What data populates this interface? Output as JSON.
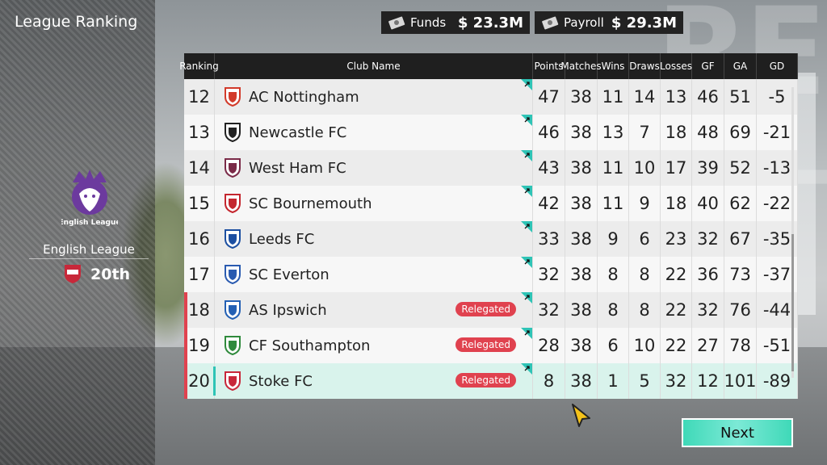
{
  "page": {
    "title": "League Ranking"
  },
  "funds": {
    "label": "Funds",
    "value": "$ 23.3M"
  },
  "payroll": {
    "label": "Payroll",
    "value": "$ 29.3M"
  },
  "league": {
    "logo_text": "English League",
    "name": "English League",
    "rank": "20th"
  },
  "table": {
    "headers": [
      "Ranking",
      "Club Name",
      "Points",
      "Matches",
      "Wins",
      "Draws",
      "Losses",
      "GF",
      "GA",
      "GD"
    ],
    "rows": [
      {
        "rank": "12",
        "club": "AC Nottingham",
        "points": "47",
        "matches": "38",
        "wins": "11",
        "draws": "14",
        "losses": "13",
        "gf": "46",
        "ga": "51",
        "gd": "-5",
        "status": "",
        "crest_color": "#d23a2a"
      },
      {
        "rank": "13",
        "club": "Newcastle FC",
        "points": "46",
        "matches": "38",
        "wins": "13",
        "draws": "7",
        "losses": "18",
        "gf": "48",
        "ga": "69",
        "gd": "-21",
        "status": "",
        "crest_color": "#222222"
      },
      {
        "rank": "14",
        "club": "West Ham FC",
        "points": "43",
        "matches": "38",
        "wins": "11",
        "draws": "10",
        "losses": "17",
        "gf": "39",
        "ga": "52",
        "gd": "-13",
        "status": "",
        "crest_color": "#7a2a48"
      },
      {
        "rank": "15",
        "club": "SC Bournemouth",
        "points": "42",
        "matches": "38",
        "wins": "11",
        "draws": "9",
        "losses": "18",
        "gf": "40",
        "ga": "62",
        "gd": "-22",
        "status": "",
        "crest_color": "#c4262e"
      },
      {
        "rank": "16",
        "club": "Leeds FC",
        "points": "33",
        "matches": "38",
        "wins": "9",
        "draws": "6",
        "losses": "23",
        "gf": "32",
        "ga": "67",
        "gd": "-35",
        "status": "",
        "crest_color": "#1c4fa1"
      },
      {
        "rank": "17",
        "club": "SC Everton",
        "points": "32",
        "matches": "38",
        "wins": "8",
        "draws": "8",
        "losses": "22",
        "gf": "36",
        "ga": "73",
        "gd": "-37",
        "status": "",
        "crest_color": "#2a5bb0"
      },
      {
        "rank": "18",
        "club": "AS Ipswich",
        "points": "32",
        "matches": "38",
        "wins": "8",
        "draws": "8",
        "losses": "22",
        "gf": "32",
        "ga": "76",
        "gd": "-44",
        "status": "Relegated",
        "crest_color": "#2360b4"
      },
      {
        "rank": "19",
        "club": "CF Southampton",
        "points": "28",
        "matches": "38",
        "wins": "6",
        "draws": "10",
        "losses": "22",
        "gf": "27",
        "ga": "78",
        "gd": "-51",
        "status": "Relegated",
        "crest_color": "#2f8a3c"
      },
      {
        "rank": "20",
        "club": "Stoke FC",
        "points": "8",
        "matches": "38",
        "wins": "1",
        "draws": "5",
        "losses": "32",
        "gf": "12",
        "ga": "101",
        "gd": "-89",
        "status": "Relegated",
        "crest_color": "#c8283a"
      }
    ]
  },
  "next_button": {
    "label": "Next"
  },
  "colors": {
    "accent": "#3fd9b8",
    "relegated": "#e0424f",
    "highlight_row": "#d9f3ec"
  }
}
